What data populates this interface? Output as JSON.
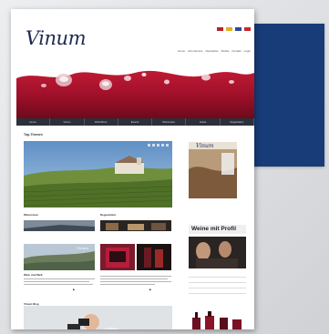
{
  "brand": {
    "logo_text": "Vinum"
  },
  "header": {
    "flags": [
      "#b8242a",
      "#e0b020",
      "#2a4a9a",
      "#c4272d"
    ],
    "top_links": [
      "Home",
      "Abo-Service",
      "Newsletter",
      "Mobile",
      "Kontakt",
      "Login"
    ]
  },
  "nav": {
    "items": [
      "Home",
      "Vinum",
      "Weinführer",
      "Events",
      "Weinreisen",
      "Guide",
      "Degustation"
    ]
  },
  "main": {
    "hero_title": "Top-Themen",
    "col1_title": "Weinreisen",
    "col2_title": "Degustation",
    "caption_wine_world": "Wein und Welt",
    "blog_title": "Vinum Blog"
  },
  "sidebar": {
    "weine_title": "Weine mit Profil",
    "rows": [
      "",
      "",
      "",
      "",
      "",
      "",
      ""
    ]
  },
  "colors": {
    "accent_navy": "#173c78",
    "nav_dark": "#2b3039",
    "wine_red": "#a0102a"
  }
}
